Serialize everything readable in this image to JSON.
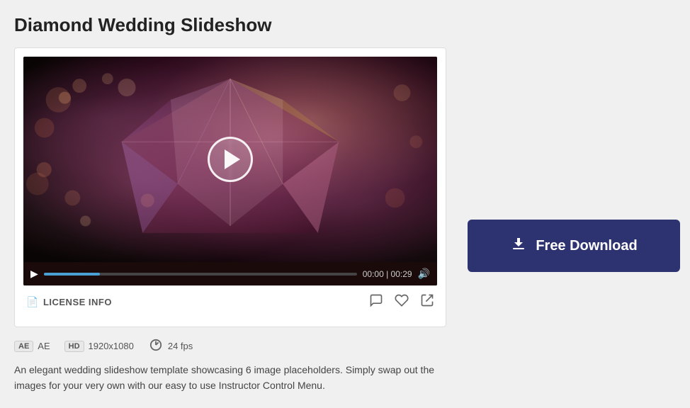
{
  "page": {
    "title": "Diamond Wedding Slideshow",
    "background_color": "#f0f0f0"
  },
  "video": {
    "duration": "00:29",
    "current_time": "00:00",
    "time_display": "00:00 | 00:29",
    "progress_percent": 18
  },
  "license": {
    "label": "LICENSE INFO"
  },
  "meta": {
    "software_badge": "AE",
    "software_label": "AE",
    "resolution_badge": "HD",
    "resolution": "1920x1080",
    "fps": "24 fps"
  },
  "description": {
    "text": "An elegant wedding slideshow template showcasing 6 image placeholders. Simply swap out the images for your very own with our easy to use Instructor Control Menu."
  },
  "download": {
    "label": "Free Download"
  },
  "icons": {
    "play_small": "▶",
    "volume": "🔊",
    "license": "📄",
    "comment": "💬",
    "heart": "♡",
    "share": "⬡",
    "download": "⬇"
  }
}
